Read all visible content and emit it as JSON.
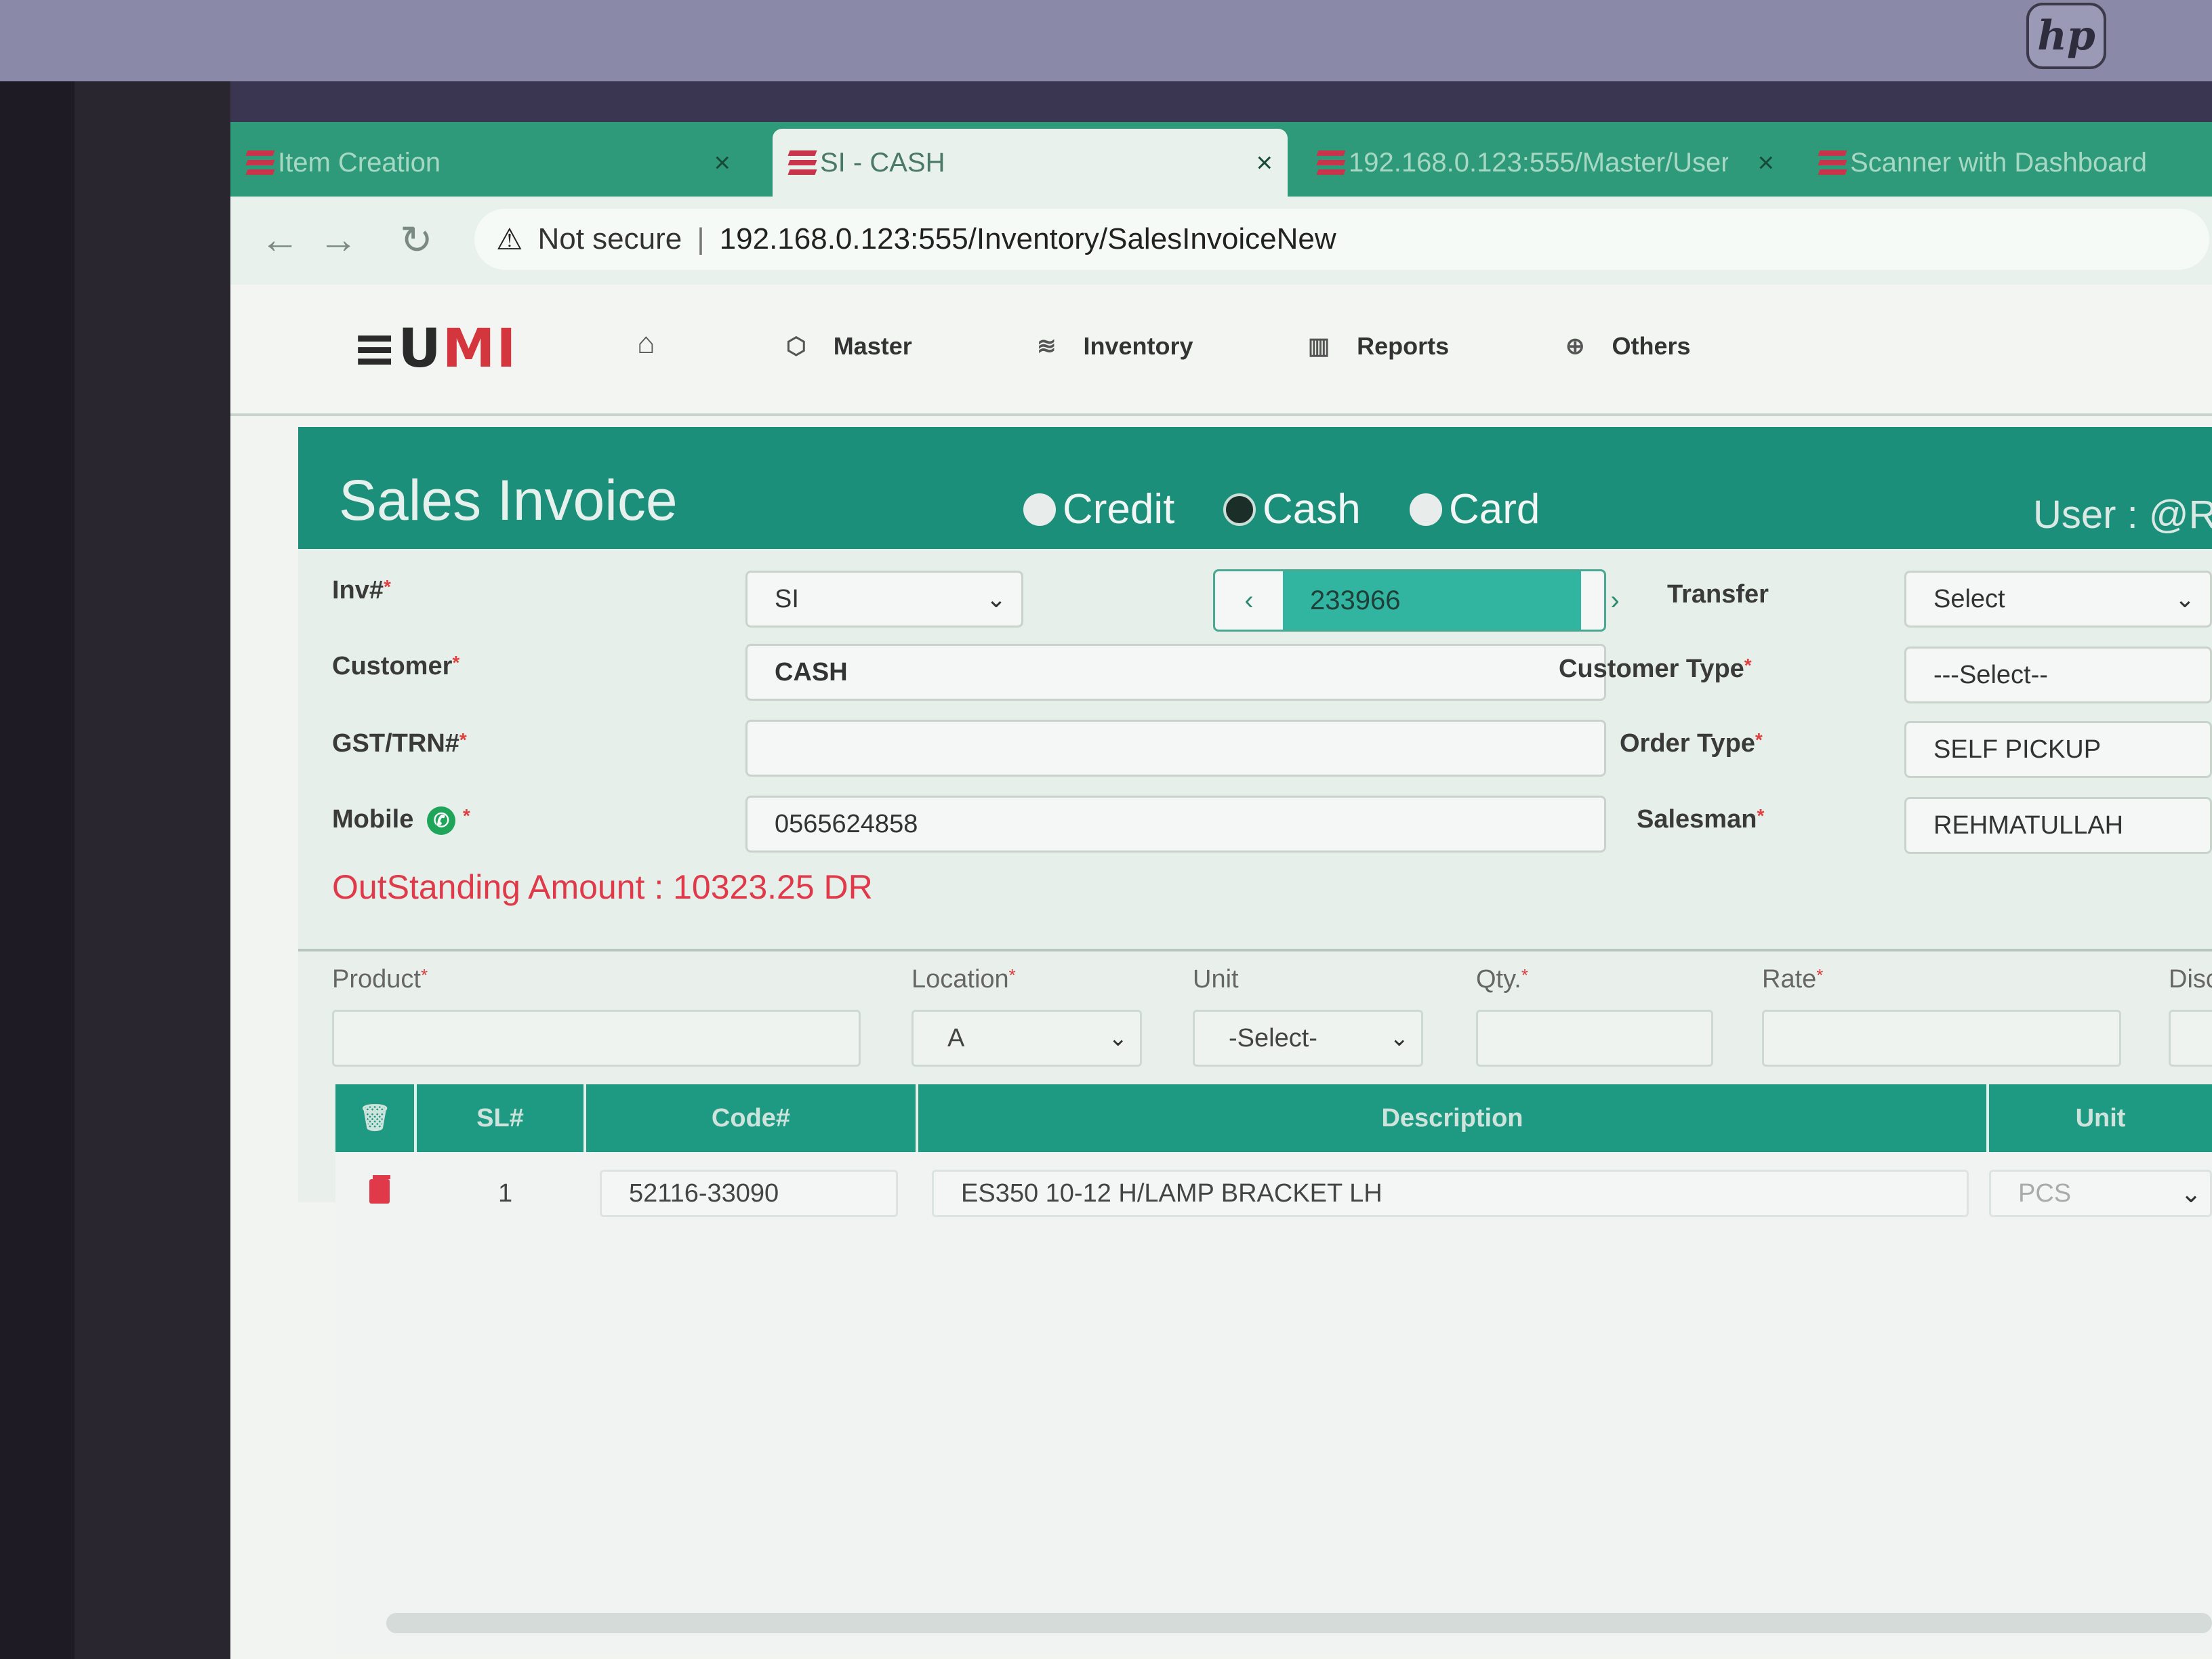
{
  "browser": {
    "tabs": [
      {
        "title": "Item Creation",
        "active": false
      },
      {
        "title": "SI - CASH",
        "active": true
      },
      {
        "title": "192.168.0.123:555/Master/User...",
        "active": false
      },
      {
        "title": "Scanner with Dashboard",
        "active": false
      }
    ],
    "close_glyph": "×",
    "security_label": "Not secure",
    "url": "192.168.0.123:555/Inventory/SalesInvoiceNew"
  },
  "brand": {
    "logo_part1": "≡U",
    "logo_part2": "MI"
  },
  "nav": {
    "items": [
      {
        "label": "Master",
        "icon": "cube-icon"
      },
      {
        "label": "Inventory",
        "icon": "layers-icon"
      },
      {
        "label": "Reports",
        "icon": "bar-chart-icon"
      },
      {
        "label": "Others",
        "icon": "globe-icon"
      }
    ]
  },
  "header": {
    "title": "Sales Invoice",
    "payment_modes": [
      {
        "label": "Credit",
        "selected": false
      },
      {
        "label": "Cash",
        "selected": true
      },
      {
        "label": "Card",
        "selected": false
      }
    ],
    "user_label": "User : @R"
  },
  "form": {
    "inv_label": "Inv#",
    "inv_prefix": "SI",
    "inv_number": "233966",
    "customer_label": "Customer",
    "customer_value": "CASH",
    "gst_label": "GST/TRN#",
    "gst_value": "",
    "mobile_label": "Mobile",
    "mobile_value": "0565624858",
    "transfer_label": "Transfer",
    "transfer_value": "Select",
    "customer_type_label": "Customer Type",
    "customer_type_value": "---Select--",
    "order_type_label": "Order Type",
    "order_type_value": "SELF PICKUP",
    "salesman_label": "Salesman",
    "salesman_value": "REHMATULLAH",
    "required_mark": "*",
    "outstanding": "OutStanding Amount : 10323.25 DR"
  },
  "entry": {
    "product_label": "Product",
    "location_label": "Location",
    "location_value": "A",
    "unit_label": "Unit",
    "unit_value": "-Select-",
    "qty_label": "Qty.",
    "rate_label": "Rate",
    "disc_label": "Disc"
  },
  "grid": {
    "headers": {
      "sl": "SL#",
      "code": "Code#",
      "description": "Description",
      "unit": "Unit"
    },
    "rows": [
      {
        "sl": "1",
        "code": "52116-33090",
        "description": "ES350 10-12 H/LAMP BRACKET LH",
        "unit": "PCS"
      }
    ]
  },
  "colors": {
    "accent": "#1b8f7a",
    "danger": "#e03a4a",
    "browser_green": "#2f9a7a"
  }
}
